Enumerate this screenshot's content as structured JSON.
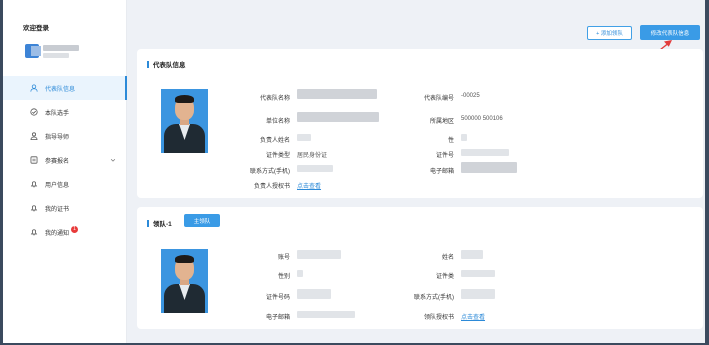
{
  "sidebar": {
    "welcome": "欢迎登录",
    "items": [
      {
        "label": "代表队信息",
        "icon": "user-icon",
        "active": true
      },
      {
        "label": "本队选手",
        "icon": "check-circle-icon"
      },
      {
        "label": "指导导师",
        "icon": "people-icon"
      },
      {
        "label": "参赛报名",
        "icon": "form-icon",
        "has_submenu": true
      },
      {
        "label": "用户信息",
        "icon": "bell-icon"
      },
      {
        "label": "我的证书",
        "icon": "bell-icon"
      },
      {
        "label": "我的通知",
        "icon": "bell-icon",
        "badge": "1"
      }
    ]
  },
  "toolbar": {
    "add_label": "+ 添加领队",
    "edit_label": "修改代表队信息"
  },
  "team_info": {
    "title": "代表队信息",
    "fields": {
      "team_name_label": "代表队名称",
      "team_no_label": "代表队编号",
      "team_no_value": "-00025",
      "unit_label": "单位名称",
      "region_label": "所属地区",
      "region_value": "500000 500106",
      "leader_name_label": "负责人姓名",
      "gender_label": "性",
      "id_type_label": "证件类型",
      "id_type_value": "居民身份证",
      "id_no_label": "证件号",
      "phone_label": "联系方式(手机)",
      "email_label": "电子邮箱",
      "auth_label": "负责人授权书",
      "auth_link": "点击查看"
    }
  },
  "leader_info": {
    "title": "领队-1",
    "tag": "主领队",
    "fields": {
      "account_label": "账号",
      "name_label": "姓名",
      "gender_label": "性别",
      "id_type_label": "证件类",
      "id_no_label": "证件号码",
      "phone_label": "联系方式(手机)",
      "email_label": "电子邮箱",
      "auth_label": "领队授权书",
      "auth_link": "点击查看"
    }
  },
  "colors": {
    "accent": "#2c8ad8",
    "button": "#3a9be6",
    "badge": "#e83a3a",
    "annotation_arrow": "#e23b3b"
  }
}
